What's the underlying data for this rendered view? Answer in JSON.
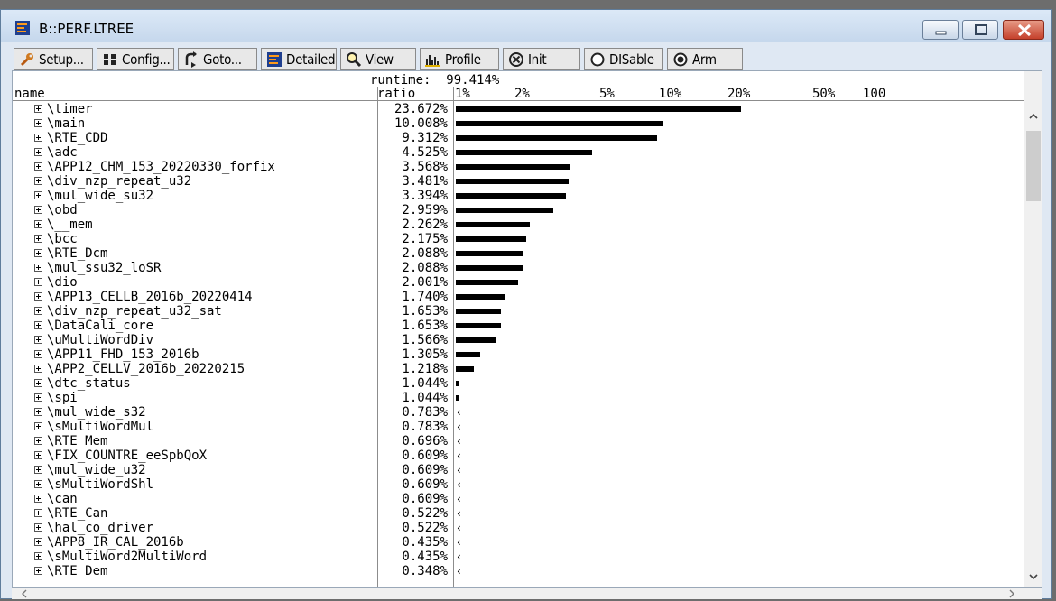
{
  "window": {
    "title": "B::PERF.LTREE"
  },
  "toolbar": {
    "buttons": [
      {
        "label": "Setup...",
        "icon": "wrench-icon"
      },
      {
        "label": "Config...",
        "icon": "grid-icon"
      },
      {
        "label": "Goto...",
        "icon": "goto-arrow-icon"
      },
      {
        "label": "Detailed",
        "icon": "detailed-list-icon"
      },
      {
        "label": "View",
        "icon": "magnifier-icon"
      },
      {
        "label": "Profile",
        "icon": "profile-bars-icon"
      },
      {
        "label": "Init",
        "icon": "init-circle-x-icon"
      },
      {
        "label": "DISable",
        "icon": "radio-off-icon"
      },
      {
        "label": "Arm",
        "icon": "radio-on-icon"
      }
    ]
  },
  "header": {
    "runtime_label": "runtime:",
    "runtime_value": "99.414%",
    "name_col": "name",
    "ratio_col": "ratio",
    "scale": [
      "1%",
      "2%",
      "5%",
      "10%",
      "20%",
      "50%",
      "100"
    ]
  },
  "rows": [
    {
      "name": "\\timer",
      "ratio": "23.672%",
      "value": 23.672
    },
    {
      "name": "\\main",
      "ratio": "10.008%",
      "value": 10.008
    },
    {
      "name": "\\RTE_CDD",
      "ratio": "9.312%",
      "value": 9.312
    },
    {
      "name": "\\adc",
      "ratio": "4.525%",
      "value": 4.525
    },
    {
      "name": "\\APP12_CHM_153_20220330_forfix",
      "ratio": "3.568%",
      "value": 3.568
    },
    {
      "name": "\\div_nzp_repeat_u32",
      "ratio": "3.481%",
      "value": 3.481
    },
    {
      "name": "\\mul_wide_su32",
      "ratio": "3.394%",
      "value": 3.394
    },
    {
      "name": "\\obd",
      "ratio": "2.959%",
      "value": 2.959
    },
    {
      "name": "\\__mem",
      "ratio": "2.262%",
      "value": 2.262
    },
    {
      "name": "\\bcc",
      "ratio": "2.175%",
      "value": 2.175
    },
    {
      "name": "\\RTE_Dcm",
      "ratio": "2.088%",
      "value": 2.088
    },
    {
      "name": "\\mul_ssu32_loSR",
      "ratio": "2.088%",
      "value": 2.088
    },
    {
      "name": "\\dio",
      "ratio": "2.001%",
      "value": 2.001
    },
    {
      "name": "\\APP13_CELLB_2016b_20220414",
      "ratio": "1.740%",
      "value": 1.74
    },
    {
      "name": "\\div_nzp_repeat_u32_sat",
      "ratio": "1.653%",
      "value": 1.653
    },
    {
      "name": "\\DataCali_core",
      "ratio": "1.653%",
      "value": 1.653
    },
    {
      "name": "\\uMultiWordDiv",
      "ratio": "1.566%",
      "value": 1.566
    },
    {
      "name": "\\APP11_FHD_153_2016b",
      "ratio": "1.305%",
      "value": 1.305
    },
    {
      "name": "\\APP2_CELLV_2016b_20220215",
      "ratio": "1.218%",
      "value": 1.218
    },
    {
      "name": "\\dtc_status",
      "ratio": "1.044%",
      "value": 1.044
    },
    {
      "name": "\\spi",
      "ratio": "1.044%",
      "value": 1.044
    },
    {
      "name": "\\mul_wide_s32",
      "ratio": "0.783%",
      "value": 0.783
    },
    {
      "name": "\\sMultiWordMul",
      "ratio": "0.783%",
      "value": 0.783
    },
    {
      "name": "\\RTE_Mem",
      "ratio": "0.696%",
      "value": 0.696
    },
    {
      "name": "\\FIX_COUNTRE_eeSpbQoX",
      "ratio": "0.609%",
      "value": 0.609
    },
    {
      "name": "\\mul_wide_u32",
      "ratio": "0.609%",
      "value": 0.609
    },
    {
      "name": "\\sMultiWordShl",
      "ratio": "0.609%",
      "value": 0.609
    },
    {
      "name": "\\can",
      "ratio": "0.609%",
      "value": 0.609
    },
    {
      "name": "\\RTE_Can",
      "ratio": "0.522%",
      "value": 0.522
    },
    {
      "name": "\\hal_co_driver",
      "ratio": "0.522%",
      "value": 0.522
    },
    {
      "name": "\\APP8_IR_CAL_2016b",
      "ratio": "0.435%",
      "value": 0.435
    },
    {
      "name": "\\sMultiWord2MultiWord",
      "ratio": "0.435%",
      "value": 0.435
    },
    {
      "name": "\\RTE_Dem",
      "ratio": "0.348%",
      "value": 0.348
    }
  ]
}
